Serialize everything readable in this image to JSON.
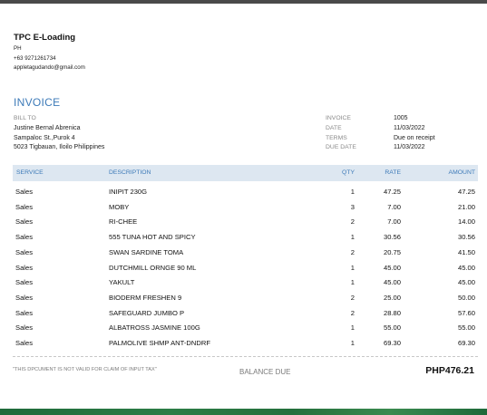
{
  "company": {
    "name": "TPC E-Loading",
    "country": "PH",
    "phone": "+63 9271261734",
    "email": "appletagudando@gmail.com"
  },
  "document": {
    "title": "INVOICE"
  },
  "bill_to": {
    "label": "BILL TO",
    "lines": [
      "Justine Bernal Abrenica",
      "Sampaloc St.,Purok 4",
      "5023 Tigbauan, Iloilo Philippines"
    ]
  },
  "meta": [
    {
      "label": "INVOICE",
      "value": "1005"
    },
    {
      "label": "DATE",
      "value": "11/03/2022"
    },
    {
      "label": "TERMS",
      "value": "Due on receipt"
    },
    {
      "label": "DUE DATE",
      "value": "11/03/2022"
    }
  ],
  "table": {
    "headers": {
      "service": "SERVICE",
      "description": "DESCRIPTION",
      "qty": "QTY",
      "rate": "RATE",
      "amount": "AMOUNT"
    },
    "rows": [
      {
        "service": "Sales",
        "description": "INIPIT 230G",
        "qty": "1",
        "rate": "47.25",
        "amount": "47.25"
      },
      {
        "service": "Sales",
        "description": "MOBY",
        "qty": "3",
        "rate": "7.00",
        "amount": "21.00"
      },
      {
        "service": "Sales",
        "description": "RI-CHEE",
        "qty": "2",
        "rate": "7.00",
        "amount": "14.00"
      },
      {
        "service": "Sales",
        "description": "555 TUNA HOT AND SPICY",
        "qty": "1",
        "rate": "30.56",
        "amount": "30.56"
      },
      {
        "service": "Sales",
        "description": "SWAN SARDINE TOMA",
        "qty": "2",
        "rate": "20.75",
        "amount": "41.50"
      },
      {
        "service": "Sales",
        "description": "DUTCHMILL ORNGE 90 ML",
        "qty": "1",
        "rate": "45.00",
        "amount": "45.00"
      },
      {
        "service": "Sales",
        "description": "YAKULT",
        "qty": "1",
        "rate": "45.00",
        "amount": "45.00"
      },
      {
        "service": "Sales",
        "description": "BIODERM FRESHEN 9",
        "qty": "2",
        "rate": "25.00",
        "amount": "50.00"
      },
      {
        "service": "Sales",
        "description": "SAFEGUARD JUMBO P",
        "qty": "2",
        "rate": "28.80",
        "amount": "57.60"
      },
      {
        "service": "Sales",
        "description": "ALBATROSS JASMINE 100G",
        "qty": "1",
        "rate": "55.00",
        "amount": "55.00"
      },
      {
        "service": "Sales",
        "description": "PALMOLIVE SHMP ANT-DNDRF",
        "qty": "1",
        "rate": "69.30",
        "amount": "69.30"
      }
    ]
  },
  "footer": {
    "note": "\"THIS DPCUMENT IS NOT VALID FOR CLAIM OF INPUT TAX\"",
    "balance_label": "BALANCE DUE",
    "balance_value": "PHP476.21"
  }
}
